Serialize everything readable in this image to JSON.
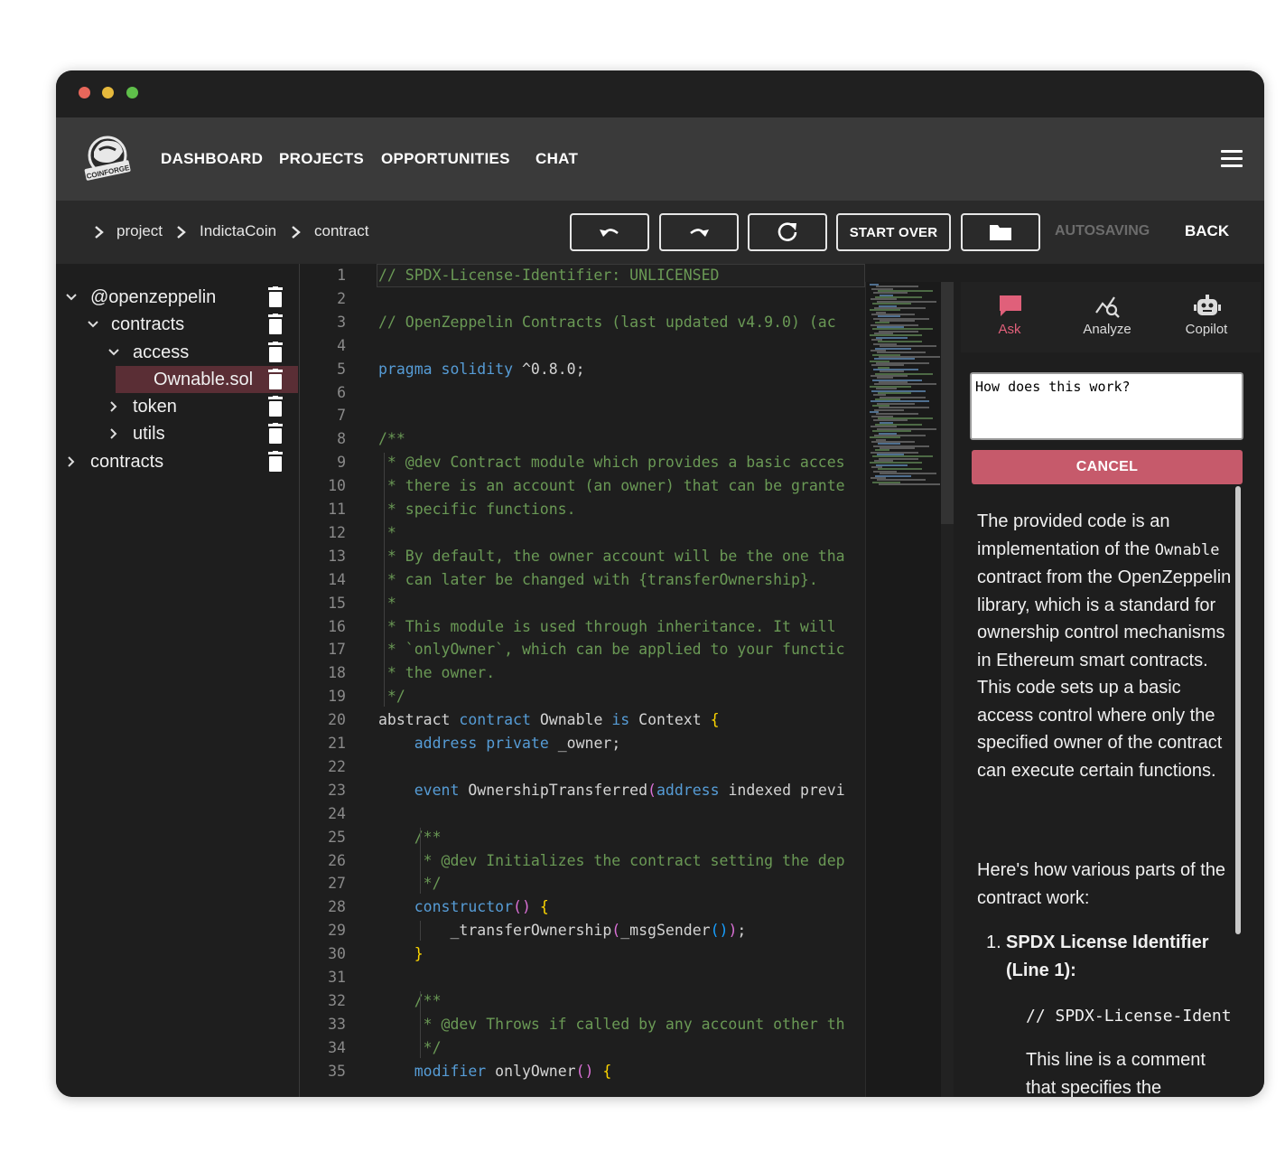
{
  "window": {
    "controls": [
      "close",
      "minimize",
      "maximize"
    ]
  },
  "navbar": {
    "logo_text": "COINFORGE",
    "links": [
      "DASHBOARD",
      "PROJECTS",
      "OPPORTUNITIES",
      "CHAT"
    ],
    "menu_icon": "hamburger-icon"
  },
  "breadcrumb": [
    "project",
    "IndictaCoin",
    "contract"
  ],
  "toolbar": {
    "undo_icon": "undo-icon",
    "redo_icon": "redo-icon",
    "refresh_icon": "refresh-icon",
    "start_over": "START OVER",
    "folder_icon": "folder-icon",
    "status": "AUTOSAVING",
    "back": "BACK"
  },
  "file_tree": [
    {
      "label": "@openzeppelin",
      "depth": 0,
      "expanded": true
    },
    {
      "label": "contracts",
      "depth": 1,
      "expanded": true
    },
    {
      "label": "access",
      "depth": 2,
      "expanded": true
    },
    {
      "label": "Ownable.sol",
      "depth": 3,
      "selected": true
    },
    {
      "label": "token",
      "depth": 2,
      "expanded": false
    },
    {
      "label": "utils",
      "depth": 2,
      "expanded": false
    },
    {
      "label": "contracts",
      "depth": 0,
      "expanded": false
    }
  ],
  "editor": {
    "language": "solidity",
    "lines": [
      "// SPDX-License-Identifier: UNLICENSED",
      "",
      "// OpenZeppelin Contracts (last updated v4.9.0) (ac",
      "",
      "pragma solidity ^0.8.0;",
      "",
      "",
      "/**",
      " * @dev Contract module which provides a basic acces",
      " * there is an account (an owner) that can be grante",
      " * specific functions.",
      " *",
      " * By default, the owner account will be the one tha",
      " * can later be changed with {transferOwnership}.",
      " *",
      " * This module is used through inheritance. It will",
      " * `onlyOwner`, which can be applied to your functic",
      " * the owner.",
      " */",
      "abstract contract Ownable is Context {",
      "    address private _owner;",
      "",
      "    event OwnershipTransferred(address indexed previ",
      "",
      "    /**",
      "     * @dev Initializes the contract setting the dep",
      "     */",
      "    constructor() {",
      "        _transferOwnership(_msgSender());",
      "    }",
      "",
      "    /**",
      "     * @dev Throws if called by any account other th",
      "     */",
      "    modifier onlyOwner() {"
    ]
  },
  "assistant": {
    "tabs": [
      {
        "label": "Ask",
        "icon": "chat-bubble-icon",
        "active": true,
        "color": "#e0607a"
      },
      {
        "label": "Analyze",
        "icon": "analyze-chart-icon",
        "active": false,
        "color": "#dcdcdc"
      },
      {
        "label": "Copilot",
        "icon": "robot-icon",
        "active": false,
        "color": "#dcdcdc"
      }
    ],
    "question": "How does this work?",
    "cancel": "CANCEL",
    "answer_p1_a": "The provided code is an implementation of the ",
    "answer_p1_code": "Ownable",
    "answer_p1_b": " contract from the OpenZeppelin library, which is a standard for ownership control mechanisms in Ethereum smart contracts. This code sets up a basic access control where only the specified owner of the contract can execute certain functions.",
    "answer_p2": "Here's how various parts of the contract work:",
    "list_num": "1.",
    "list_item_1": "SPDX License Identifier (Line 1):",
    "answer_code": "// SPDX-License-Ident",
    "answer_p3": "This line is a comment that specifies the"
  },
  "colors": {
    "accent": "#c65a6b",
    "navbar": "#3a3a3a",
    "editor_bg": "#1e1e1e"
  }
}
